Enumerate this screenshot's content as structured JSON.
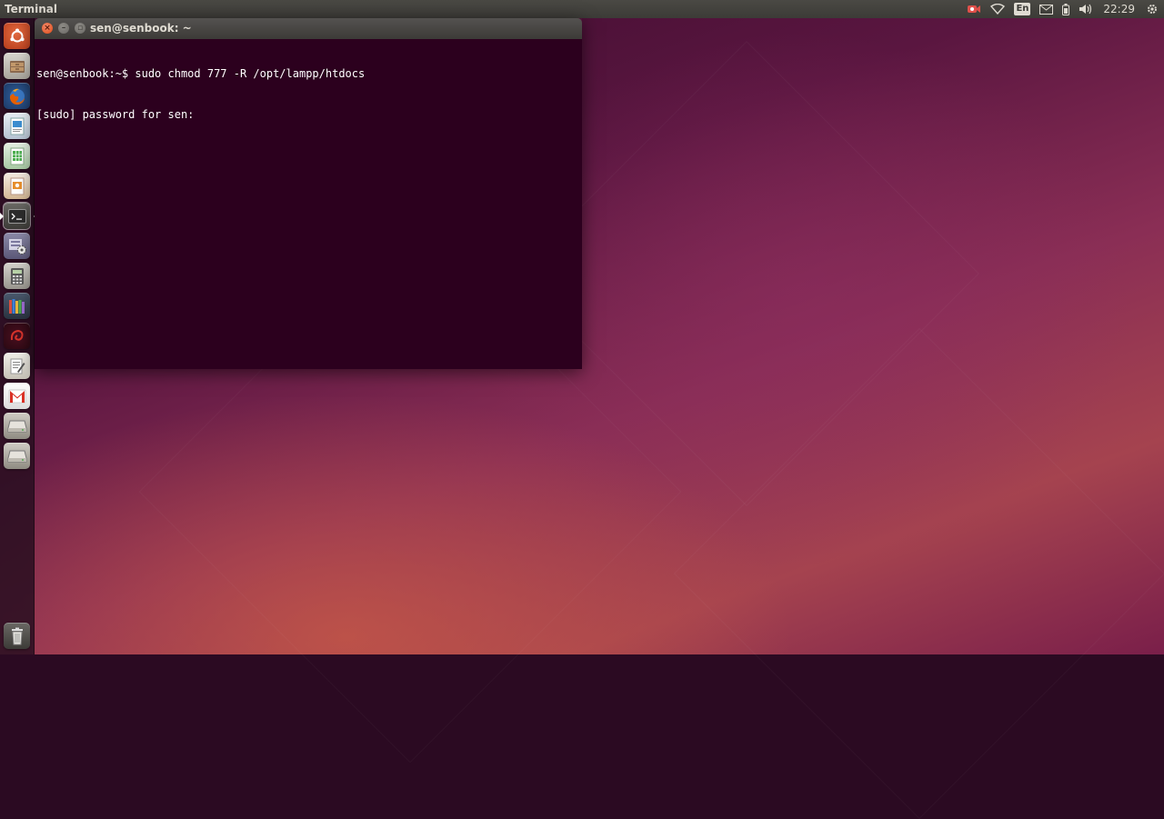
{
  "top_panel": {
    "app_name": "Terminal",
    "keyboard_layout": "En",
    "clock": "22:29",
    "indicators": [
      "camera-icon",
      "wifi-icon",
      "keyboard-icon",
      "mail-icon",
      "battery-icon",
      "volume-icon",
      "gear-icon"
    ]
  },
  "launcher": {
    "items": [
      {
        "name": "dash-home",
        "icon": "ubuntu-logo-icon"
      },
      {
        "name": "files",
        "icon": "file-cabinet-icon"
      },
      {
        "name": "firefox",
        "icon": "firefox-icon"
      },
      {
        "name": "libreoffice-writer",
        "icon": "writer-document-icon"
      },
      {
        "name": "libreoffice-calc",
        "icon": "calc-spreadsheet-icon"
      },
      {
        "name": "libreoffice-impress",
        "icon": "impress-presentation-icon"
      },
      {
        "name": "terminal",
        "icon": "terminal-icon",
        "active": true
      },
      {
        "name": "system-settings",
        "icon": "settings-icon"
      },
      {
        "name": "calculator",
        "icon": "calculator-icon"
      },
      {
        "name": "library",
        "icon": "books-icon"
      },
      {
        "name": "app-red",
        "icon": "swirl-icon"
      },
      {
        "name": "text-editor",
        "icon": "text-editor-icon"
      },
      {
        "name": "gmail",
        "icon": "gmail-icon"
      },
      {
        "name": "drive-1",
        "icon": "drive-icon"
      },
      {
        "name": "drive-2",
        "icon": "drive-icon"
      },
      {
        "name": "trash",
        "icon": "trash-icon"
      }
    ]
  },
  "terminal": {
    "title": "sen@senbook: ~",
    "lines": [
      "sen@senbook:~$ sudo chmod 777 -R /opt/lampp/htdocs",
      "[sudo] password for sen: "
    ]
  },
  "colors": {
    "terminal_bg": "#2c001e",
    "panel_bg": "#3c3b37",
    "close_button": "#df4a16"
  }
}
